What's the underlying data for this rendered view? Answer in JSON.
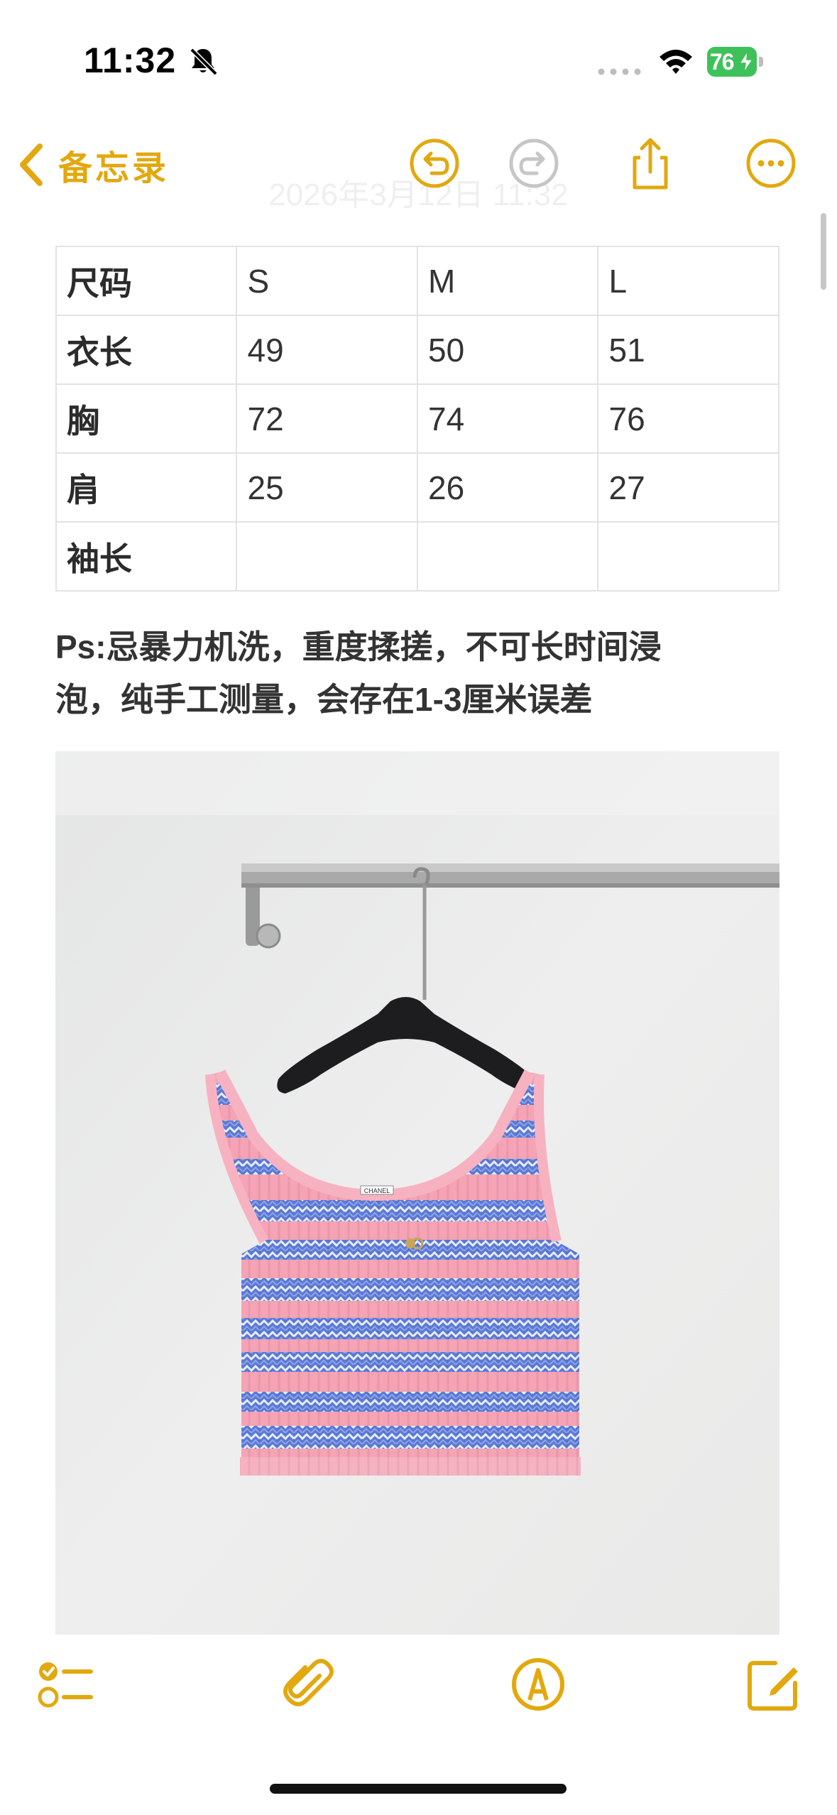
{
  "status_bar": {
    "time": "11:32",
    "battery": "76"
  },
  "nav": {
    "back_label": "备忘录",
    "faded_date": "2026年3月12日 11:32"
  },
  "table": {
    "rows": [
      [
        "尺码",
        "S",
        "M",
        "L"
      ],
      [
        "衣长",
        "49",
        "50",
        "51"
      ],
      [
        "胸",
        "72",
        "74",
        "76"
      ],
      [
        "肩",
        "25",
        "26",
        "27"
      ],
      [
        "袖长",
        "",
        "",
        ""
      ]
    ]
  },
  "note": {
    "line1": "Ps:忌暴力机洗，重度揉搓，不可长时间浸",
    "line2": "泡，纯手工测量，会存在1-3厘米误差"
  },
  "photo": {
    "garment_label": "CHANEL"
  },
  "colors": {
    "accent": "#e2a80e",
    "garment_pink": "#f5a3b5",
    "garment_blue": "#5b79d6",
    "wall": "#ececec"
  },
  "icons": {
    "back": "chevron-left-icon",
    "undo": "undo-icon",
    "redo": "redo-icon",
    "share": "share-icon",
    "more": "more-icon",
    "checklist": "checklist-icon",
    "attachment": "paperclip-icon",
    "markup": "markup-pen-icon",
    "compose": "compose-icon"
  }
}
